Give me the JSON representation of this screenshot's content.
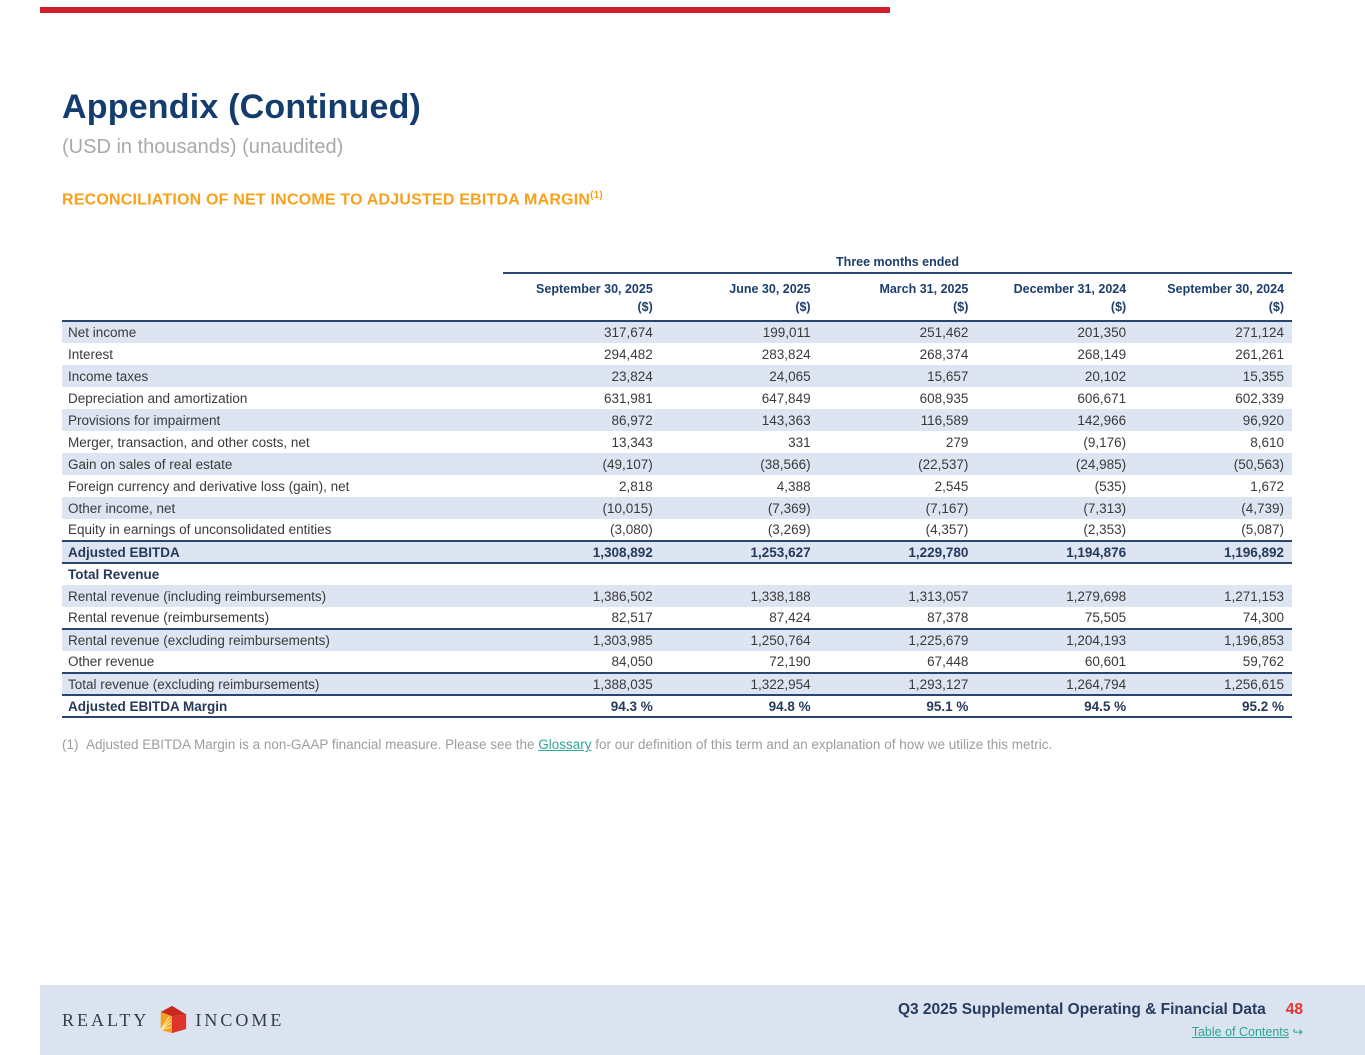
{
  "page": {
    "title": "Appendix (Continued)",
    "subtitle": "(USD in thousands) (unaudited)",
    "section_heading": "RECONCILIATION OF NET INCOME TO ADJUSTED EBITDA MARGIN",
    "section_heading_note": "(1)"
  },
  "colors": {
    "top_bar_red": "#d0202e",
    "navy": "#1d3e6d",
    "orange": "#f7a11a",
    "teal": "#2fa596",
    "page_number_red": "#e63430",
    "row_stripe": "#dde4f2",
    "footer_bg": "#dbe2f0"
  },
  "table": {
    "span_header": "Three months ended",
    "columns": [
      "September 30, 2025",
      "June 30, 2025",
      "March 31, 2025",
      "December 31, 2024",
      "September 30, 2024"
    ],
    "unit_label": "($)",
    "rows": [
      {
        "label": "Net income",
        "values": [
          "317,674",
          "199,011",
          "251,462",
          "201,350",
          "271,124"
        ]
      },
      {
        "label": "Interest",
        "values": [
          "294,482",
          "283,824",
          "268,374",
          "268,149",
          "261,261"
        ]
      },
      {
        "label": "Income taxes",
        "values": [
          "23,824",
          "24,065",
          "15,657",
          "20,102",
          "15,355"
        ]
      },
      {
        "label": "Depreciation and amortization",
        "values": [
          "631,981",
          "647,849",
          "608,935",
          "606,671",
          "602,339"
        ]
      },
      {
        "label": "Provisions for impairment",
        "values": [
          "86,972",
          "143,363",
          "116,589",
          "142,966",
          "96,920"
        ]
      },
      {
        "label": "Merger, transaction, and other costs, net",
        "values": [
          "13,343",
          "331",
          "279",
          "(9,176)",
          "8,610"
        ]
      },
      {
        "label": "Gain on sales of real estate",
        "values": [
          "(49,107)",
          "(38,566)",
          "(22,537)",
          "(24,985)",
          "(50,563)"
        ]
      },
      {
        "label": "Foreign currency and derivative loss (gain), net",
        "values": [
          "2,818",
          "4,388",
          "2,545",
          "(535)",
          "1,672"
        ]
      },
      {
        "label": "Other income, net",
        "values": [
          "(10,015)",
          "(7,369)",
          "(7,167)",
          "(7,313)",
          "(4,739)"
        ]
      },
      {
        "label": "Equity in earnings of unconsolidated entities",
        "values": [
          "(3,080)",
          "(3,269)",
          "(4,357)",
          "(2,353)",
          "(5,087)"
        ]
      },
      {
        "label": "Adjusted EBITDA",
        "values": [
          "1,308,892",
          "1,253,627",
          "1,229,780",
          "1,194,876",
          "1,196,892"
        ],
        "bold": true,
        "rule_above": true,
        "rule_below": true
      },
      {
        "label": "Total Revenue",
        "values": [
          "",
          "",
          "",
          "",
          ""
        ],
        "bold": true
      },
      {
        "label": "Rental revenue (including reimbursements)",
        "values": [
          "1,386,502",
          "1,338,188",
          "1,313,057",
          "1,279,698",
          "1,271,153"
        ]
      },
      {
        "label": "Rental revenue (reimbursements)",
        "values": [
          "82,517",
          "87,424",
          "87,378",
          "75,505",
          "74,300"
        ],
        "rule_below": true
      },
      {
        "label": "Rental revenue (excluding reimbursements)",
        "values": [
          "1,303,985",
          "1,250,764",
          "1,225,679",
          "1,204,193",
          "1,196,853"
        ]
      },
      {
        "label": "Other revenue",
        "values": [
          "84,050",
          "72,190",
          "67,448",
          "60,601",
          "59,762"
        ],
        "rule_below": true
      },
      {
        "label": "Total revenue (excluding reimbursements)",
        "values": [
          "1,388,035",
          "1,322,954",
          "1,293,127",
          "1,264,794",
          "1,256,615"
        ],
        "rule_below": true
      },
      {
        "label": "Adjusted EBITDA Margin",
        "values": [
          "94.3 %",
          "94.8 %",
          "95.1 %",
          "94.5 %",
          "95.2 %"
        ],
        "bold": true,
        "rule_below": true
      }
    ]
  },
  "footnote": {
    "marker": "(1)",
    "text_before": "Adjusted EBITDA Margin is a non-GAAP financial measure. Please see the ",
    "link_label": "Glossary",
    "text_after": " for our definition of this term and an explanation of how we utilize this metric."
  },
  "footer": {
    "logo_word_left": "REALTY",
    "logo_word_right": "INCOME",
    "doc_title": "Q3 2025 Supplemental Operating & Financial Data",
    "page_number": "48",
    "toc_label": "Table of Contents",
    "toc_arrow": "↪"
  }
}
